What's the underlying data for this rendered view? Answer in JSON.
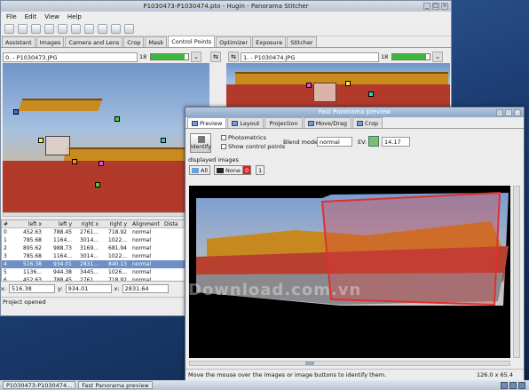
{
  "window": {
    "title": "P1030473-P1030474.pto - Hugin - Panorama Stitcher",
    "menu": [
      "File",
      "Edit",
      "View",
      "Help"
    ],
    "tabs": [
      "Assistant",
      "Images",
      "Camera and Lens",
      "Crop",
      "Mask",
      "Control Points",
      "Optimizer",
      "Exposure",
      "Stitcher"
    ],
    "active_tab": "Control Points",
    "left_image": {
      "label": "0. - P1030473.JPG",
      "cp_count": "18",
      "progress": 0.9
    },
    "right_image": {
      "label": "1. - P1030474.JPG",
      "cp_count": "18",
      "progress": 0.9
    },
    "table": {
      "headers": [
        "#",
        "left x",
        "left y",
        "right x",
        "right y",
        "Alignment",
        "Dista"
      ],
      "rows": [
        [
          "0",
          "452.63",
          "788.45",
          "2761...",
          "718.92",
          "normal",
          ""
        ],
        [
          "1",
          "785.68",
          "1164...",
          "3014...",
          "1022...",
          "normal",
          ""
        ],
        [
          "2",
          "895.62",
          "988.73",
          "3169...",
          "681.94",
          "normal",
          ""
        ],
        [
          "3",
          "785.68",
          "1164...",
          "3014...",
          "1022...",
          "normal",
          ""
        ],
        [
          "4",
          "516.38",
          "934.01",
          "2831...",
          "840.13",
          "normal",
          ""
        ],
        [
          "5",
          "1136...",
          "944.38",
          "3445...",
          "1026...",
          "normal",
          ""
        ],
        [
          "6",
          "452.63",
          "788.45",
          "2761...",
          "718.92",
          "normal",
          ""
        ]
      ],
      "selected_row": 4
    },
    "coords": {
      "x_label": "x:",
      "x_value": "516.38",
      "y_label": "y:",
      "y_value": "934.01",
      "x2_label": "x:",
      "x2_value": "2831.64"
    },
    "status": "Project opened"
  },
  "preview": {
    "title": "Fast Panorama preview",
    "tabs": [
      "Preview",
      "Layout",
      "Projection",
      "Move/Drag",
      "Crop"
    ],
    "identify_label": "Identify",
    "photometrics_label": "Photometrics",
    "show_cp_label": "Show control points",
    "blend_label": "Blend mode:",
    "blend_value": "normal",
    "ev_label": "EV:",
    "ev_value": "14.17",
    "displayed_label": "displayed images",
    "all_label": "All",
    "none_label": "None",
    "image_buttons": [
      "0",
      "1"
    ],
    "status_text": "Move the mouse over the images or image buttons to identify them.",
    "size_text": "126.0 x 65.4"
  },
  "taskbar": {
    "items": [
      "P1030473-P1030474...",
      "Fast Panorama preview"
    ]
  },
  "watermark": "Download.com.vn",
  "colors": {
    "progress": "#3ab83a",
    "selection": "#6e8fc4",
    "highlight": "#e03030"
  }
}
